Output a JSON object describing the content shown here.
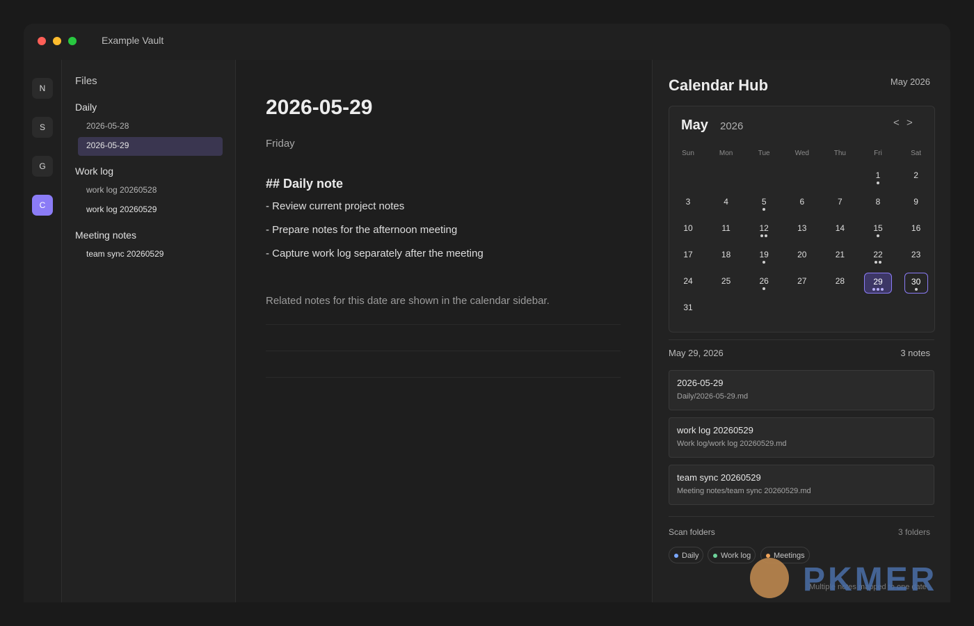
{
  "window": {
    "title": "Example Vault"
  },
  "ribbon": [
    {
      "label": "N",
      "active": false
    },
    {
      "label": "S",
      "active": false
    },
    {
      "label": "G",
      "active": false
    },
    {
      "label": "C",
      "active": true
    }
  ],
  "files": {
    "header": "Files",
    "folders": [
      {
        "name": "Daily",
        "items": [
          "2026-05-28",
          "2026-05-29"
        ]
      },
      {
        "name": "Work log",
        "items": [
          "work log 20260528",
          "work log 20260529"
        ]
      },
      {
        "name": "Meeting notes",
        "items": [
          "team sync 20260529"
        ]
      }
    ],
    "active_item": "2026-05-29"
  },
  "editor": {
    "title": "2026-05-29",
    "weekday": "Friday",
    "heading": "## Daily note",
    "bullets": [
      "- Review current project notes",
      "- Prepare notes for the afternoon meeting",
      "- Capture work log separately after the meeting"
    ],
    "related": "Related notes for this date are shown in the calendar sidebar."
  },
  "sidebar": {
    "title": "Calendar Hub",
    "month_label": "May 2026",
    "calendar": {
      "month": "May",
      "year": "2026",
      "prev": "<",
      "next": ">",
      "weekdays": [
        "Sun",
        "Mon",
        "Tue",
        "Wed",
        "Thu",
        "Fri",
        "Sat"
      ],
      "first_weekday": 5,
      "days_in_month": 31,
      "dots": {
        "1": 1,
        "5": 1,
        "12": 2,
        "15": 1,
        "19": 1,
        "22": 2,
        "26": 1,
        "29": 3,
        "30": 1
      },
      "today": 29,
      "selected": 30
    },
    "selected_date": "May 29, 2026",
    "note_count": "3 notes",
    "notes": [
      {
        "title": "2026-05-29",
        "path": "Daily/2026-05-29.md"
      },
      {
        "title": "work log 20260529",
        "path": "Work log/work log 20260529.md"
      },
      {
        "title": "team sync 20260529",
        "path": "Meeting notes/team sync 20260529.md"
      }
    ],
    "scan_label": "Scan folders",
    "scan_count": "3 folders",
    "chips": [
      {
        "label": "Daily",
        "color": "#7aa7ff"
      },
      {
        "label": "Work log",
        "color": "#6dd39a"
      },
      {
        "label": "Meetings",
        "color": "#f0a35a"
      }
    ],
    "footnote": "Multiple notes mapped to one date"
  },
  "watermark": {
    "text": "PKMER"
  },
  "colors": {
    "accent": "#8b7cf6",
    "today_bg": "#3d3766"
  }
}
